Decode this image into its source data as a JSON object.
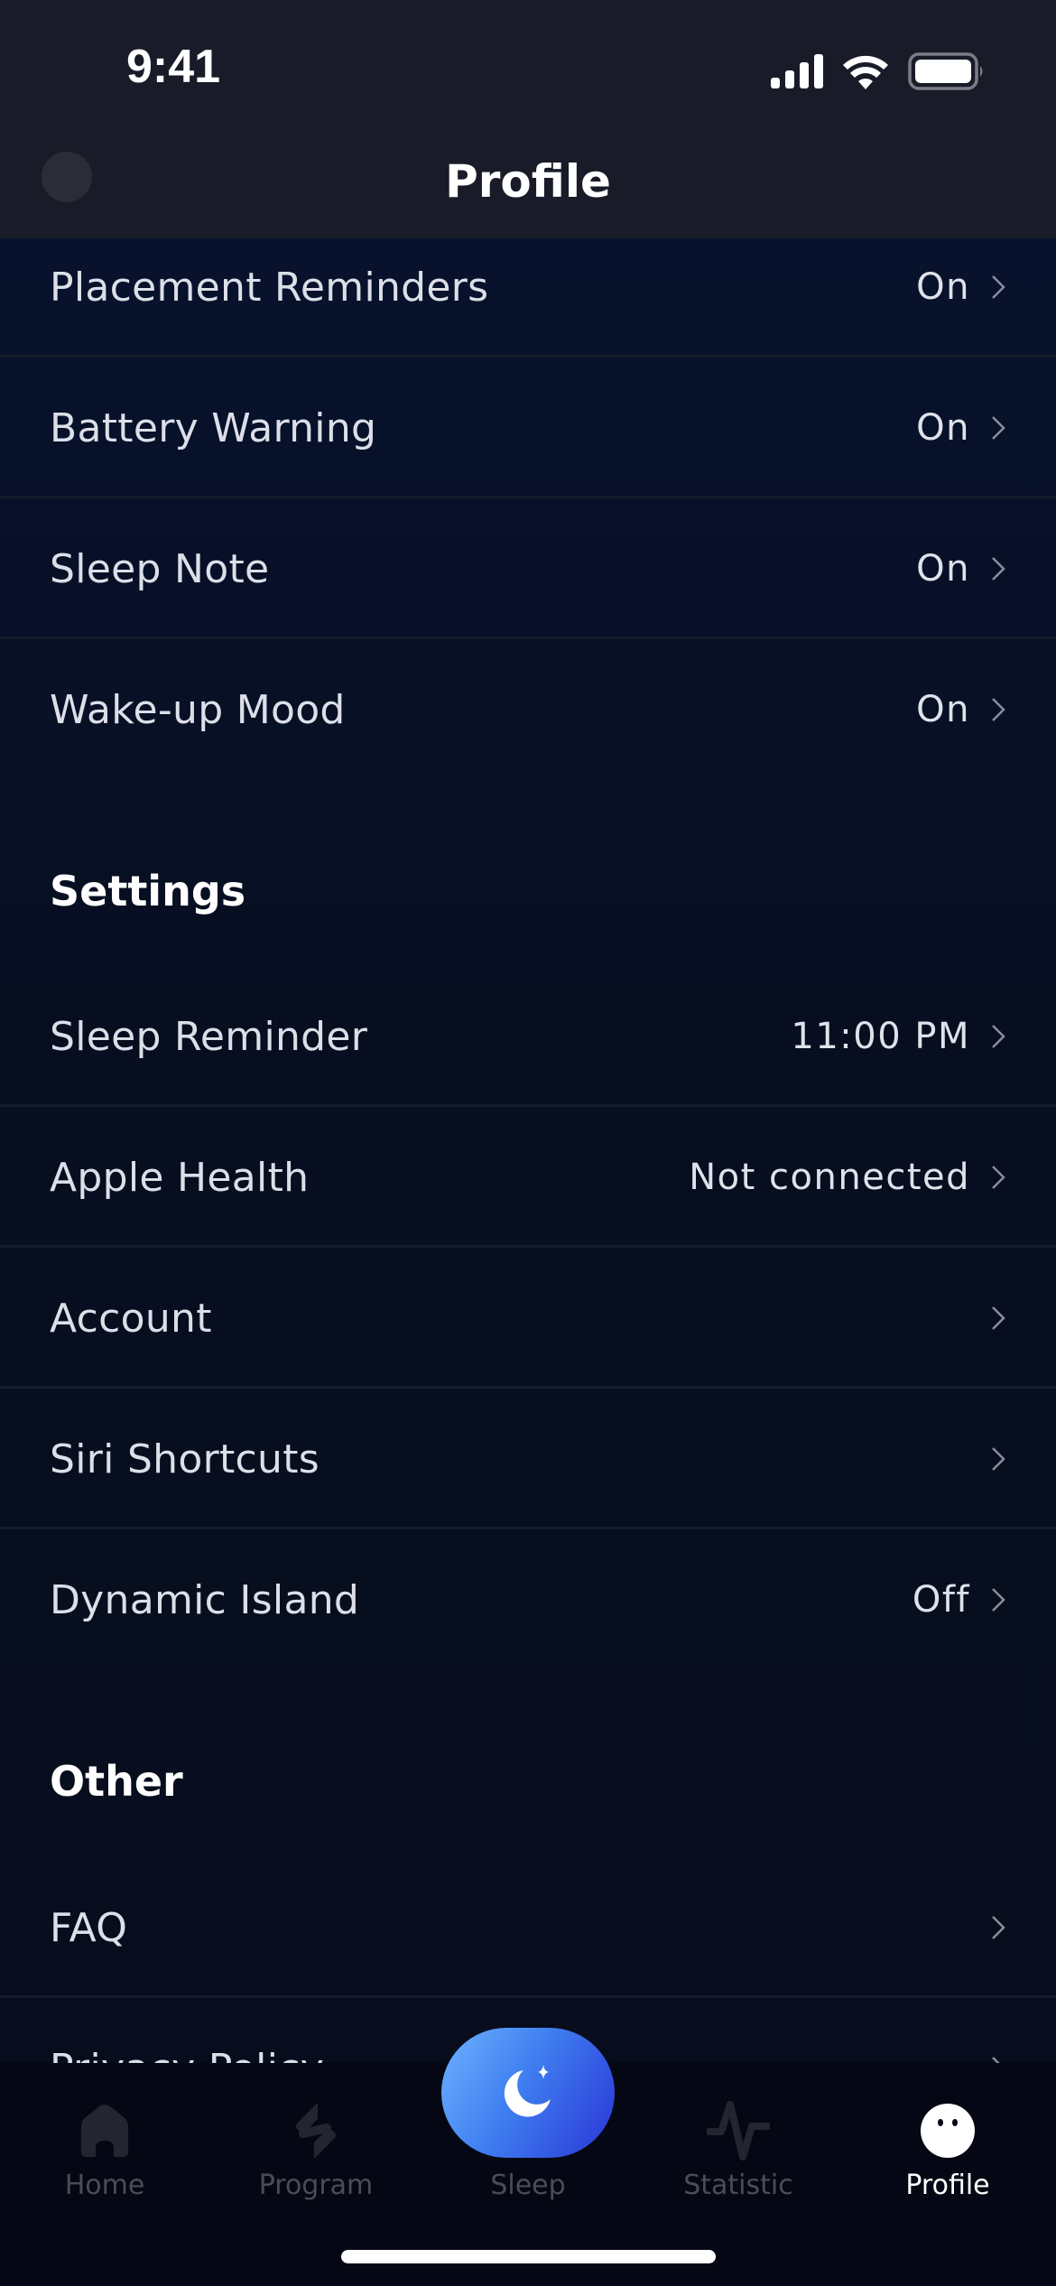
{
  "status_bar": {
    "time": "9:41"
  },
  "header": {
    "title": "Profile"
  },
  "top_group": {
    "items": [
      {
        "label": "Placement Reminders",
        "value": "On"
      },
      {
        "label": "Battery Warning",
        "value": "On"
      },
      {
        "label": "Sleep Note",
        "value": "On"
      },
      {
        "label": "Wake-up Mood",
        "value": "On"
      }
    ]
  },
  "settings": {
    "title": "Settings",
    "items": [
      {
        "label": "Sleep Reminder",
        "value": "11:00 PM"
      },
      {
        "label": "Apple Health",
        "value": "Not connected"
      },
      {
        "label": "Account",
        "value": ""
      },
      {
        "label": "Siri Shortcuts",
        "value": ""
      },
      {
        "label": "Dynamic Island",
        "value": "Off"
      }
    ]
  },
  "other": {
    "title": "Other",
    "items": [
      {
        "label": "FAQ",
        "value": ""
      },
      {
        "label": "Privacy Policy",
        "value": ""
      }
    ]
  },
  "tabbar": {
    "tabs": [
      {
        "label": "Home",
        "icon": "home-icon",
        "active": false
      },
      {
        "label": "Program",
        "icon": "program-icon",
        "active": false
      },
      {
        "label": "Sleep",
        "icon": "moon-star-icon",
        "active": false
      },
      {
        "label": "Statistic",
        "icon": "pulse-icon",
        "active": false
      },
      {
        "label": "Profile",
        "icon": "face-icon",
        "active": true
      }
    ]
  },
  "colors": {
    "header_bg": "#191c28",
    "content_bg": "#08132b",
    "tabbar_bg": "#050814",
    "sleep_button_gradient": [
      "#6eb2ff",
      "#2a35d6"
    ],
    "inactive_tab": "#4a4d58",
    "active_tab": "#ffffff"
  }
}
